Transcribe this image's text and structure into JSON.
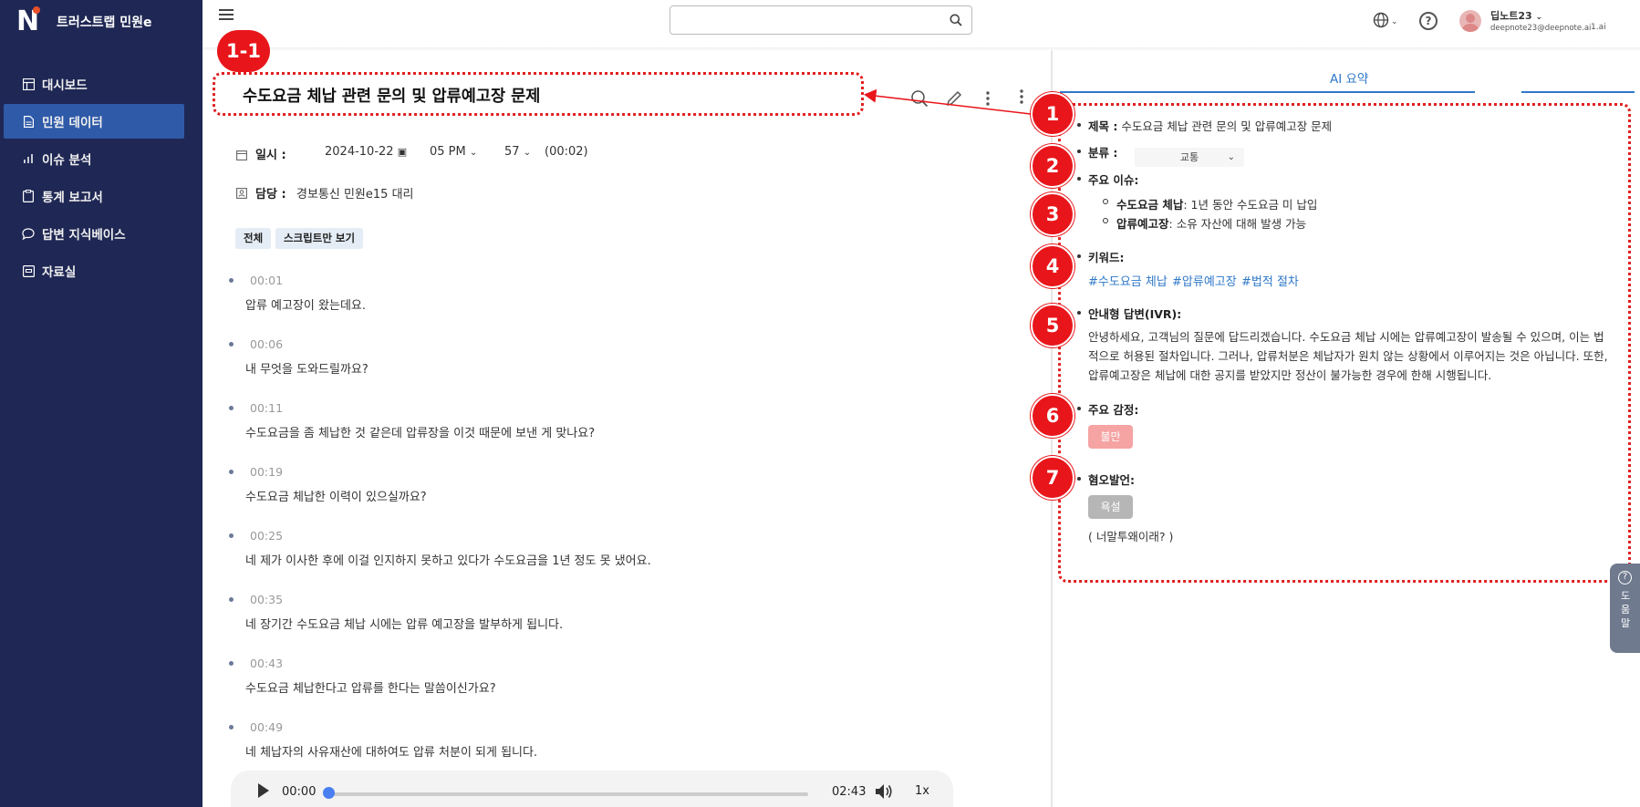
{
  "brand": "트러스트랩 민원e",
  "sidebar": {
    "items": [
      {
        "label": "대시보드",
        "icon": "dashboard-icon"
      },
      {
        "label": "민원 데이터",
        "icon": "document-icon"
      },
      {
        "label": "이슈 분석",
        "icon": "bar-chart-icon"
      },
      {
        "label": "통계 보고서",
        "icon": "clipboard-icon"
      },
      {
        "label": "답변 지식베이스",
        "icon": "chat-icon"
      },
      {
        "label": "자료실",
        "icon": "archive-icon"
      }
    ],
    "active_index": 1
  },
  "header": {
    "search_placeholder": "",
    "user_name": "딥노트23",
    "user_email": "deepnote23@deepnote.ai",
    "user_org": "1.ai"
  },
  "detail": {
    "callout_label": "1-1",
    "title": "수도요금 체납 관련 문의 및 압류예고장 문제",
    "date_label": "일시 :",
    "date": "2024-10-22",
    "hour": "05 PM",
    "minute": "57",
    "duration": "(00:02)",
    "owner_label": "담당 :",
    "owner": "경보통신 민원e15 대리",
    "chips": [
      "전체",
      "스크립트만 보기"
    ]
  },
  "transcript": [
    {
      "time": "00:01",
      "text": "압류 예고장이 왔는데요."
    },
    {
      "time": "00:06",
      "text": "내 무엇을 도와드릴까요?"
    },
    {
      "time": "00:11",
      "text": "수도요금을 좀 체납한 것 같은데 압류장을 이것 때문에 보낸 게 맞나요?"
    },
    {
      "time": "00:19",
      "text": "수도요금 체납한 이력이 있으실까요?"
    },
    {
      "time": "00:25",
      "text": "네 제가 이사한 후에 이걸 인지하지 못하고 있다가 수도요금을 1년 정도 못 냈어요."
    },
    {
      "time": "00:35",
      "text": "네 장기간 수도요금 체납 시에는 압류 예고장을 발부하게 됩니다."
    },
    {
      "time": "00:43",
      "text": "수도요금 체납한다고 압류를 한다는 말씀이신가요?"
    },
    {
      "time": "00:49",
      "text": "네 체납자의 사유재산에 대하여도 압류 처분이 되게 됩니다."
    }
  ],
  "player": {
    "current": "00:00",
    "total": "02:43",
    "speed": "1x",
    "progress": 0
  },
  "summary": {
    "tab_label": "AI 요약",
    "numbers": [
      "1",
      "2",
      "3",
      "4",
      "5",
      "6",
      "7"
    ],
    "title_label": "제목 :",
    "title_value": "수도요금 체납 관련 문의 및 압류예고장 문제",
    "category_label": "분류 :",
    "category_value": "교통",
    "issues_label": "주요 이슈:",
    "issues": [
      {
        "name": "수도요금 체납",
        "desc": ": 1년 동안 수도요금 미 납입"
      },
      {
        "name": "압류예고장",
        "desc": ": 소유 자산에 대해 발생 가능"
      }
    ],
    "keywords_label": "키워드:",
    "keywords": [
      "#수도요금 체납",
      "#압류예고장",
      "#법적 절차"
    ],
    "ivr_label": "안내형 답변(IVR):",
    "ivr_text": "안녕하세요, 고객님의 질문에 답드리겠습니다. 수도요금 체납 시에는 압류예고장이 발송될 수 있으며, 이는 법적으로 허용된 절차입니다. 그러나, 압류처분은 체납자가 원치 않는 상황에서 이루어지는 것은 아닙니다. 또한, 압류예고장은 체납에 대한 공지를 받았지만 정산이 불가능한 경우에 한해 시행됩니다.",
    "emotion_label": "주요 감정:",
    "emotion_value": "불만",
    "hate_label": "혐오발언:",
    "hate_value": "욕설",
    "hate_quote": "( 너말투왜이래? )"
  },
  "help_tab": {
    "label": "도움말"
  },
  "colors": {
    "sidebar": "#1f2754",
    "active": "#2f5aa8",
    "accent": "#2f78c8",
    "callout": "#e8161b"
  }
}
